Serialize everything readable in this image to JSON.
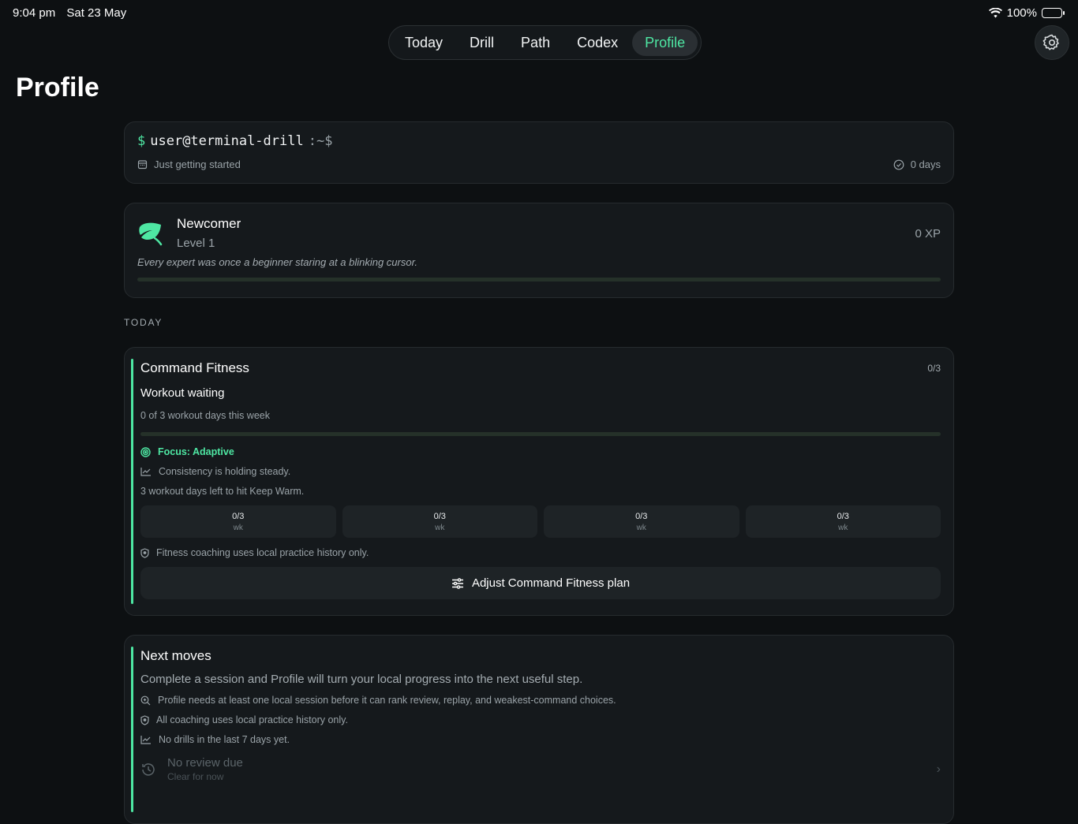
{
  "status": {
    "time": "9:04 pm",
    "date": "Sat 23 May",
    "battery": "100%"
  },
  "tabs": [
    {
      "label": "Today",
      "active": false
    },
    {
      "label": "Drill",
      "active": false
    },
    {
      "label": "Path",
      "active": false
    },
    {
      "label": "Codex",
      "active": false
    },
    {
      "label": "Profile",
      "active": true
    }
  ],
  "page": {
    "title": "Profile"
  },
  "terminal": {
    "prompt_symbol": "$",
    "user": "user@terminal-drill",
    "path": ":~$",
    "status": "Just getting started",
    "streak": "0 days"
  },
  "level": {
    "name": "Newcomer",
    "level": "Level 1",
    "xp": "0 XP",
    "quote": "Every expert was once a beginner staring at a blinking cursor.",
    "progress": 0
  },
  "section_today": "TODAY",
  "fitness": {
    "title": "Command Fitness",
    "count": "0/3",
    "state": "Workout waiting",
    "summary": "0 of 3 workout days this week",
    "progress": 0,
    "focus": "Focus: Adaptive",
    "consistency": "Consistency is holding steady.",
    "remaining": "3 workout days left to hit Keep Warm.",
    "weeks": [
      {
        "value": "0/3",
        "unit": "wk"
      },
      {
        "value": "0/3",
        "unit": "wk"
      },
      {
        "value": "0/3",
        "unit": "wk"
      },
      {
        "value": "0/3",
        "unit": "wk"
      }
    ],
    "privacy": "Fitness coaching uses local practice history only.",
    "adjust_label": "Adjust Command Fitness plan"
  },
  "moves": {
    "title": "Next moves",
    "lead": "Complete a session and Profile will turn your local progress into the next useful step.",
    "item1": "Profile needs at least one local session before it can rank review, replay, and weakest-command choices.",
    "item2": "All coaching uses local practice history only.",
    "item3": "No drills in the last 7 days yet.",
    "review_title": "No review due",
    "review_sub": "Clear for now"
  },
  "colors": {
    "accent": "#4ee7a3",
    "background": "#0d1012",
    "card": "#15191c"
  }
}
